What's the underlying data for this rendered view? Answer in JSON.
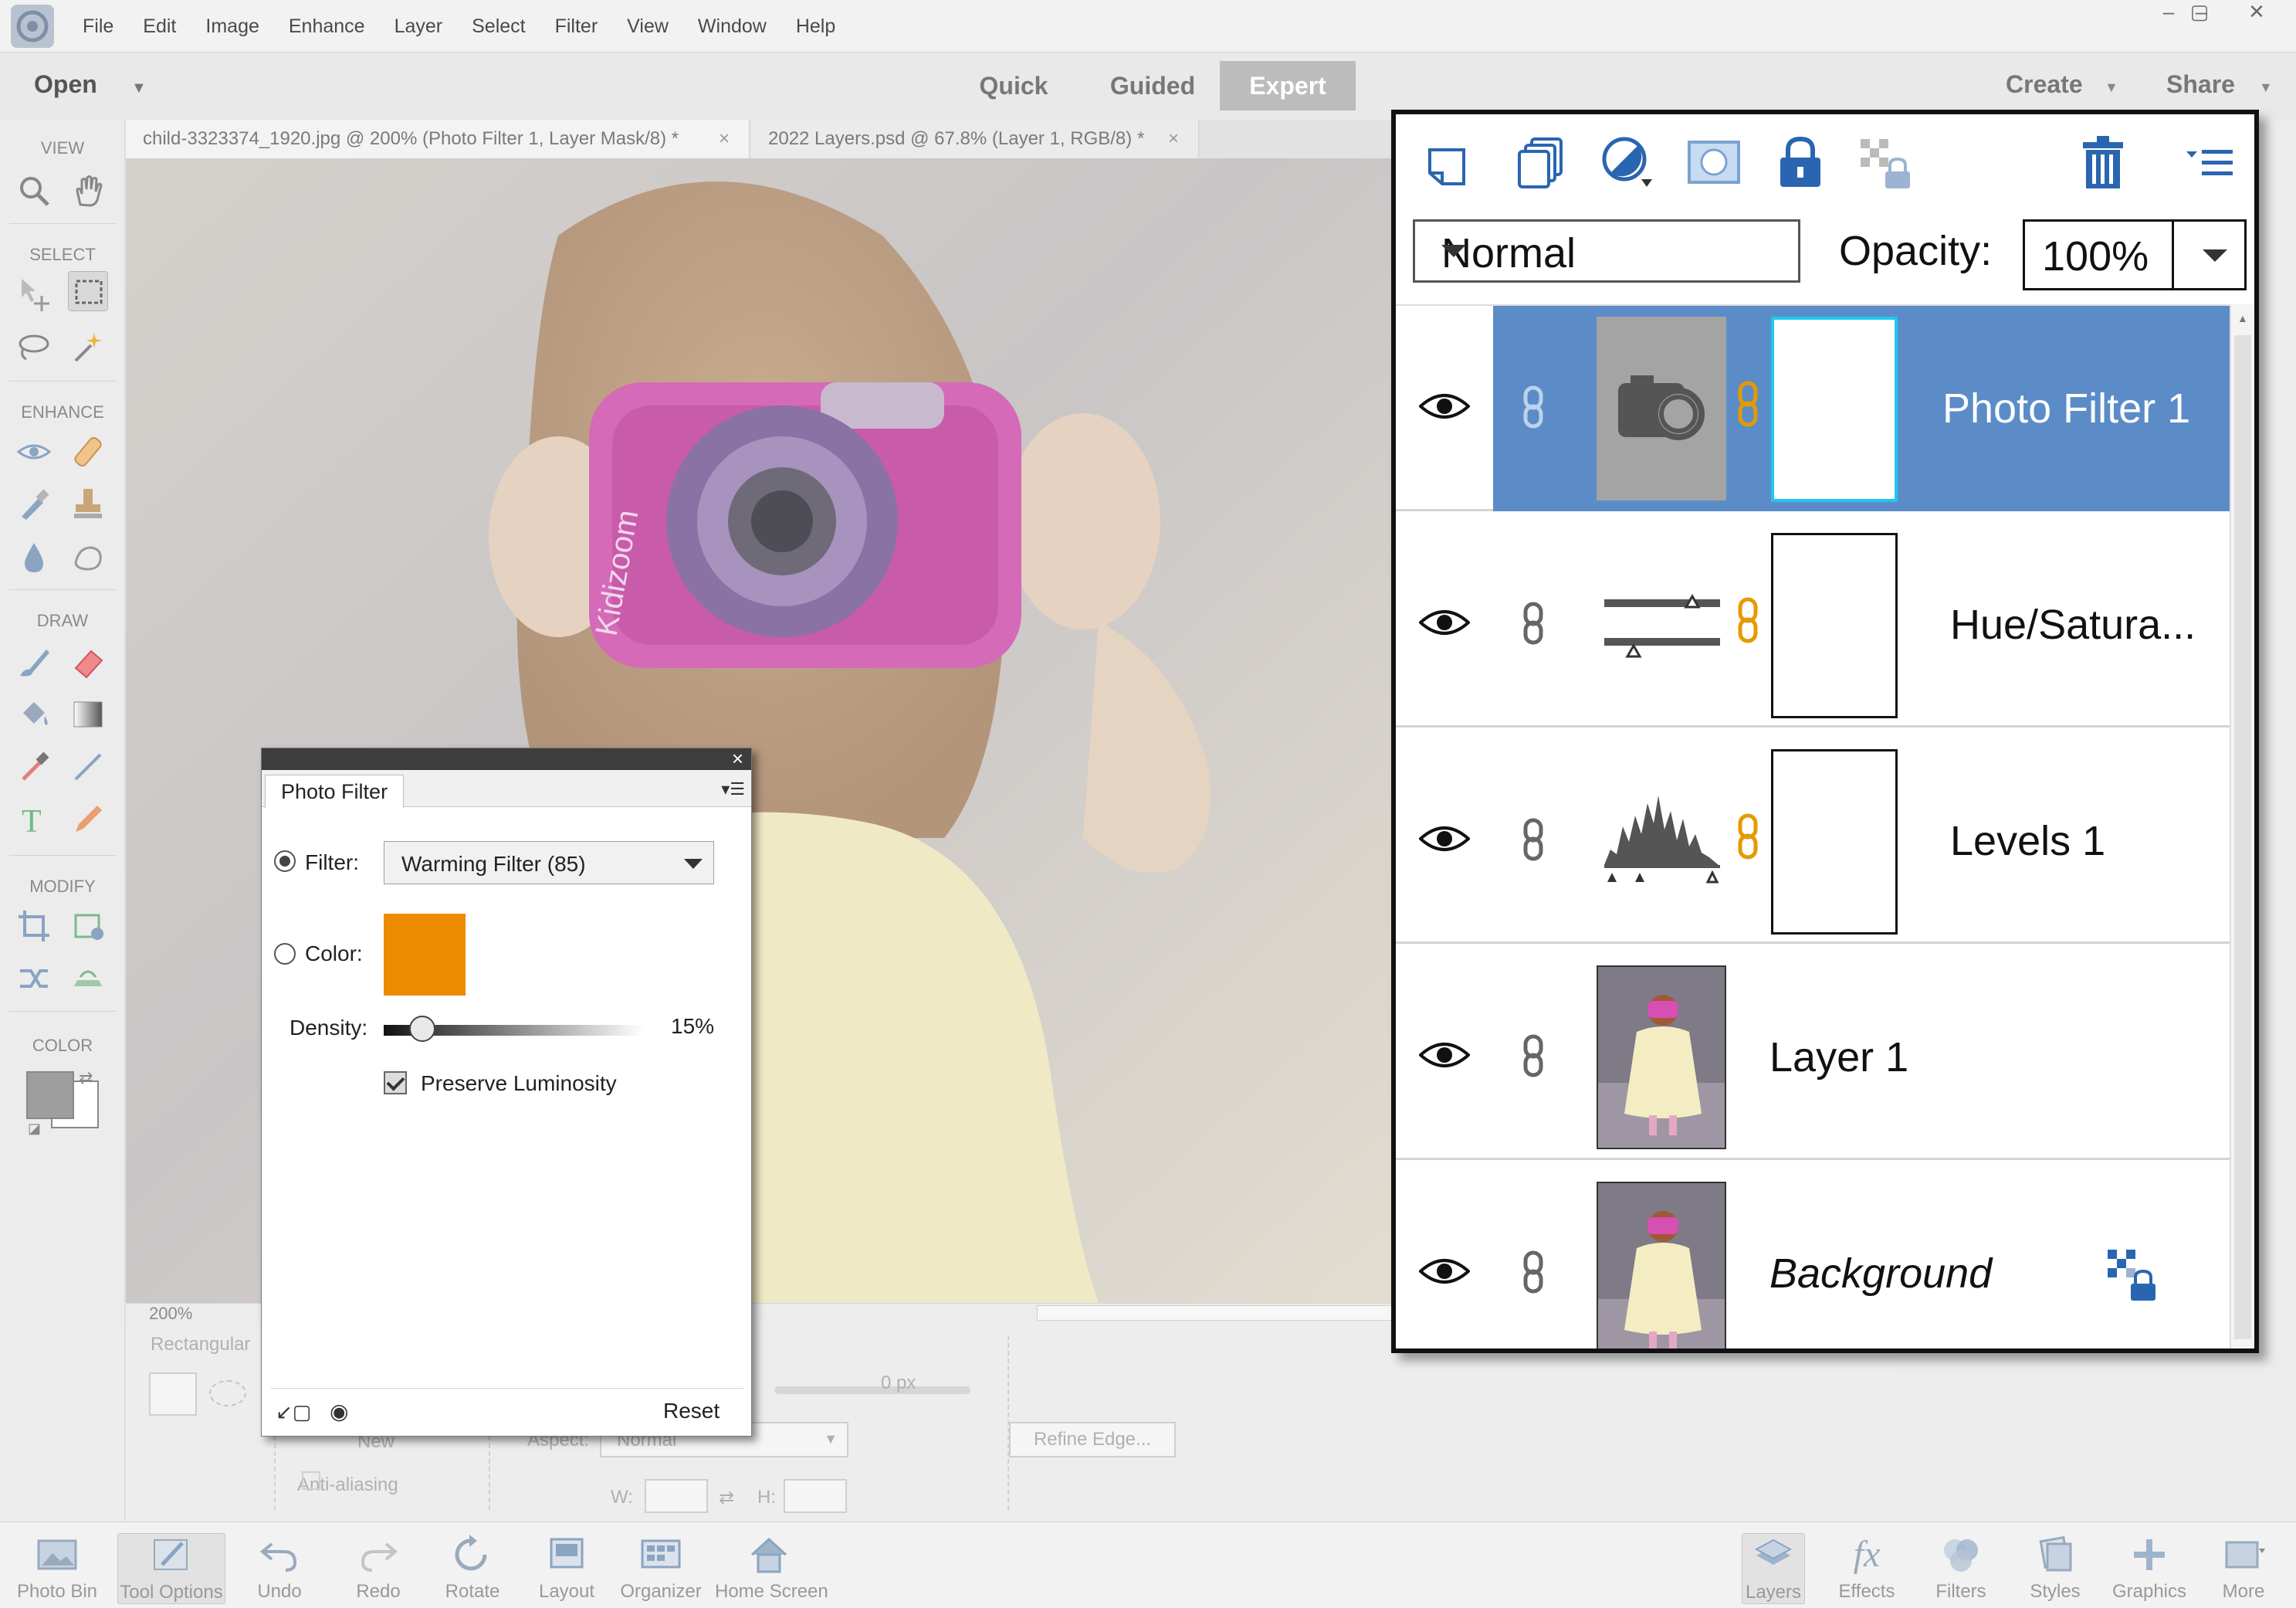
{
  "menubar": {
    "items": [
      "File",
      "Edit",
      "Image",
      "Enhance",
      "Layer",
      "Select",
      "Filter",
      "View",
      "Window",
      "Help"
    ],
    "window_controls": [
      "–",
      "▢",
      "✕"
    ]
  },
  "modebar": {
    "open_label": "Open",
    "modes": [
      "Quick",
      "Guided",
      "Expert"
    ],
    "active_mode": "Expert",
    "create_label": "Create",
    "share_label": "Share"
  },
  "toolbar": {
    "sections": [
      "VIEW",
      "SELECT",
      "ENHANCE",
      "DRAW",
      "MODIFY",
      "COLOR"
    ]
  },
  "tabs": [
    {
      "label": "child-3323374_1920.jpg @ 200% (Photo Filter 1, Layer Mask/8) *",
      "close": "×"
    },
    {
      "label": "2022 Layers.psd @ 67.8% (Layer 1, RGB/8) *",
      "close": "×"
    }
  ],
  "canvas": {
    "camera_brand": "Kidizoom",
    "zoom": "200%"
  },
  "tool_options": {
    "tool_name": "Rectangular",
    "feather_value": "0 px",
    "new_label": "New",
    "aspect_label": "Aspect:",
    "aspect_value": "Normal",
    "anti_alias_label": "Anti-aliasing",
    "w_label": "W:",
    "h_label": "H:",
    "refine_edge_label": "Refine Edge..."
  },
  "photo_filter": {
    "tab_label": "Photo Filter",
    "filter_label": "Filter:",
    "filter_value": "Warming Filter (85)",
    "color_label": "Color:",
    "color_swatch": "#ec8a00",
    "density_label": "Density:",
    "density_value": "15%",
    "density_fraction": 0.15,
    "preserve_label": "Preserve Luminosity",
    "preserve_checked": true,
    "reset_label": "Reset"
  },
  "layers_panel": {
    "blend_mode": "Normal",
    "opacity_label": "Opacity:",
    "opacity_value": "100%",
    "toolbar_icons": [
      "new-layer-icon",
      "new-group-icon",
      "adjustment-layer-icon",
      "layer-mask-icon",
      "lock-all-icon",
      "lock-transparent-icon",
      "trash-icon",
      "panel-menu-icon"
    ],
    "accent": "#5b8cc8",
    "layers": [
      {
        "name": "Photo Filter 1",
        "kind": "photo-filter",
        "selected": true,
        "has_mask": true
      },
      {
        "name": "Hue/Satura...",
        "kind": "hue-saturation",
        "selected": false,
        "has_mask": true
      },
      {
        "name": "Levels 1",
        "kind": "levels",
        "selected": false,
        "has_mask": true
      },
      {
        "name": "Layer 1",
        "kind": "image",
        "selected": false,
        "has_mask": false
      },
      {
        "name": "Background",
        "kind": "image",
        "selected": false,
        "has_mask": false,
        "locked": true
      }
    ]
  },
  "bottombar": {
    "left": [
      "Photo Bin",
      "Tool Options",
      "Undo",
      "Redo",
      "Rotate",
      "Layout",
      "Organizer",
      "Home Screen"
    ],
    "right": [
      "Layers",
      "Effects",
      "Filters",
      "Styles",
      "Graphics",
      "More"
    ],
    "fx_glyph": "fx"
  }
}
